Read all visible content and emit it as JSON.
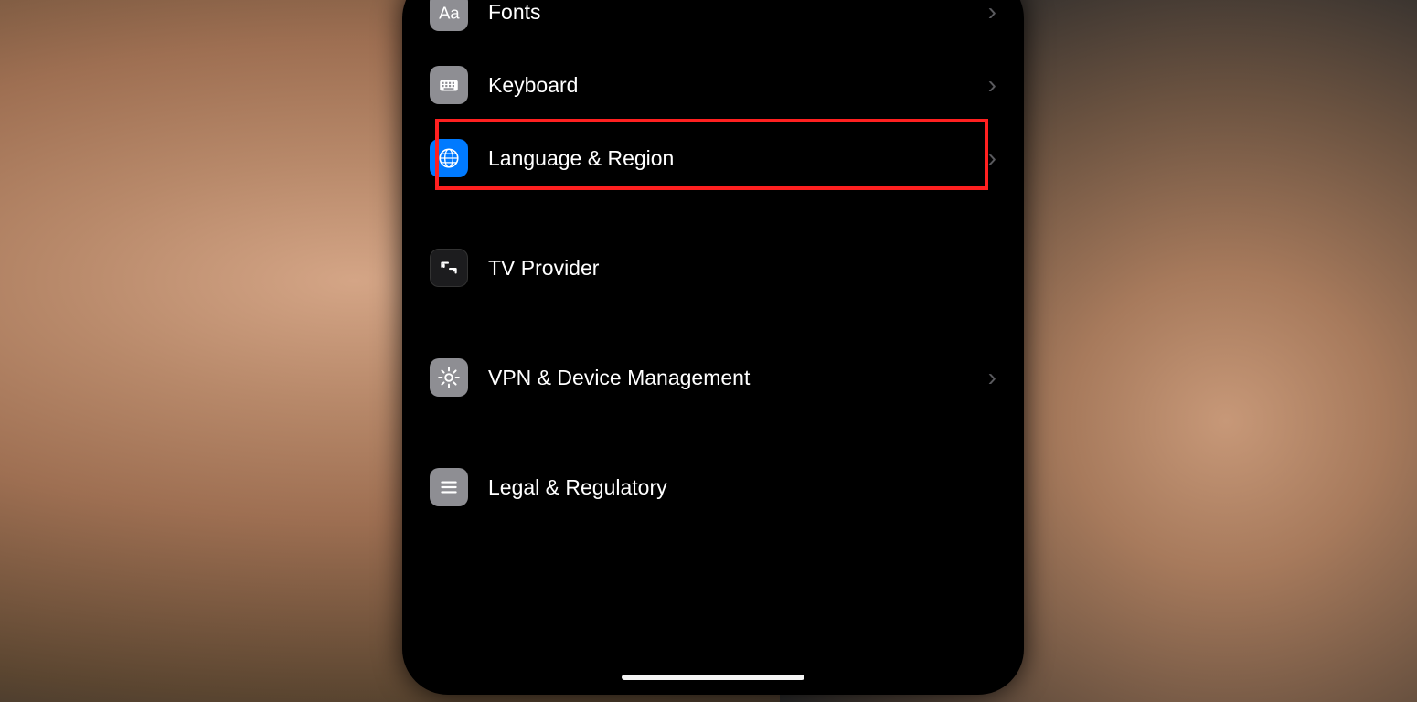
{
  "settings": {
    "sections": [
      {
        "rows": [
          {
            "id": "fonts",
            "label": "Fonts",
            "icon": "fonts-icon",
            "iconStyle": "gray",
            "hasChevron": true
          },
          {
            "id": "keyboard",
            "label": "Keyboard",
            "icon": "keyboard-icon",
            "iconStyle": "gray",
            "hasChevron": true
          },
          {
            "id": "language_region",
            "label": "Language & Region",
            "icon": "globe-icon",
            "iconStyle": "blue",
            "hasChevron": true,
            "highlighted": true
          }
        ]
      },
      {
        "rows": [
          {
            "id": "tv_provider",
            "label": "TV Provider",
            "icon": "tv-provider-icon",
            "iconStyle": "dark",
            "hasChevron": false
          }
        ]
      },
      {
        "rows": [
          {
            "id": "vpn_device",
            "label": "VPN & Device Management",
            "icon": "gear-icon",
            "iconStyle": "gray",
            "hasChevron": true
          }
        ]
      },
      {
        "rows": [
          {
            "id": "legal",
            "label": "Legal & Regulatory",
            "icon": "document-icon",
            "iconStyle": "gray",
            "hasChevron": false
          }
        ]
      }
    ]
  },
  "chevron_glyph": "›"
}
